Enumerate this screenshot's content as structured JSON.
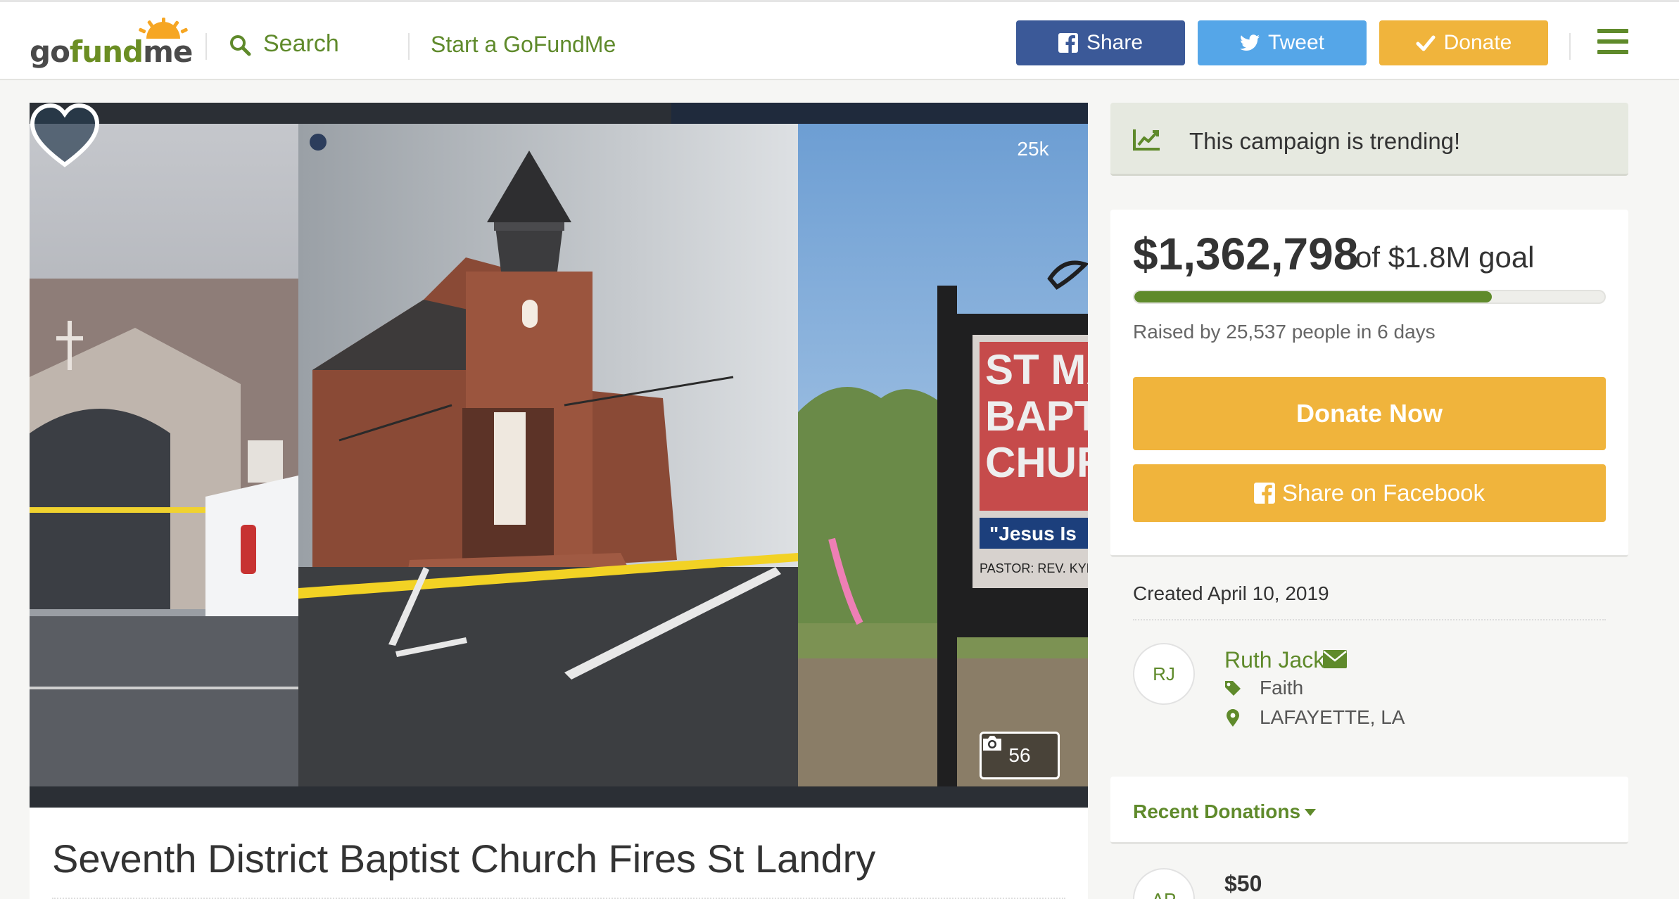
{
  "header": {
    "logo": {
      "part1": "go",
      "part2": "fund",
      "part3": "me"
    },
    "search_label": "Search",
    "start_link": "Start a GoFundMe",
    "share_label": "Share",
    "tweet_label": "Tweet",
    "donate_label": "Donate"
  },
  "hero": {
    "heart_count": "25k",
    "photo_count": "56",
    "sign_text": [
      "ST MA",
      "BAPT",
      "CHUR",
      "\"Jesus Is",
      "PASTOR: REV. KYLE T."
    ]
  },
  "campaign": {
    "title": "Seventh District Baptist Church Fires St Landry"
  },
  "sidebar": {
    "trending_text": "This campaign is trending!",
    "raised_amount": "$1,362,798",
    "goal_text": "of $1.8M goal",
    "progress_fraction": 0.76,
    "raised_by": "Raised by 25,537 people in 6 days",
    "donate_now_label": "Donate Now",
    "share_facebook_label": "Share on Facebook",
    "created": "Created April 10, 2019",
    "organizer": {
      "initials": "RJ",
      "name": "Ruth Jack",
      "category": "Faith",
      "location": "LAFAYETTE, LA"
    },
    "recent_donations_label": "Recent Donations",
    "recent_donation": {
      "initials": "AP",
      "amount": "$50"
    }
  },
  "colors": {
    "brand_green": "#5f8a2b",
    "facebook_blue": "#3b5998",
    "twitter_blue": "#55a6e8",
    "donate_orange": "#f0b43c"
  },
  "icons": [
    "search-icon",
    "facebook-icon",
    "twitter-icon",
    "check-icon",
    "hamburger-menu-icon",
    "heart-icon",
    "camera-icon",
    "trending-chart-icon",
    "envelope-icon",
    "tag-icon",
    "map-marker-icon",
    "caret-down-icon"
  ]
}
